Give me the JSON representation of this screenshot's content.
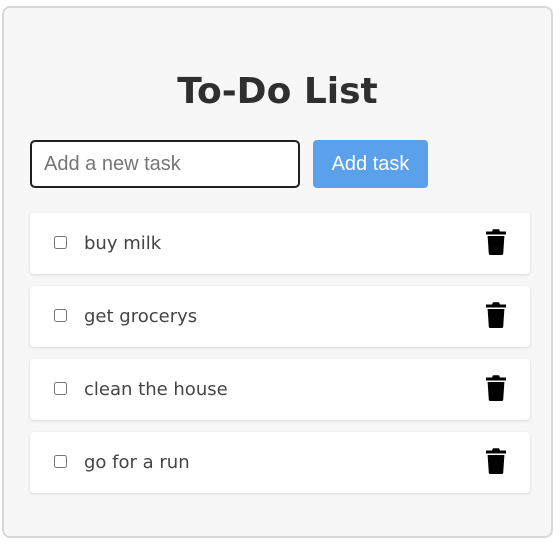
{
  "header": {
    "title": "To-Do List"
  },
  "new_task": {
    "value": "",
    "placeholder": "Add a new task",
    "add_label": "Add task"
  },
  "tasks": [
    {
      "text": "buy milk",
      "checked": false,
      "delete_icon": "trash-icon"
    },
    {
      "text": "get grocerys",
      "checked": false,
      "delete_icon": "trash-icon"
    },
    {
      "text": "clean the house",
      "checked": false,
      "delete_icon": "trash-icon"
    },
    {
      "text": "go for a run",
      "checked": false,
      "delete_icon": "trash-icon"
    }
  ],
  "colors": {
    "accent": "#5aa0eb",
    "panel_background": "#f7f7f7",
    "title_text": "#2f2f2f"
  }
}
